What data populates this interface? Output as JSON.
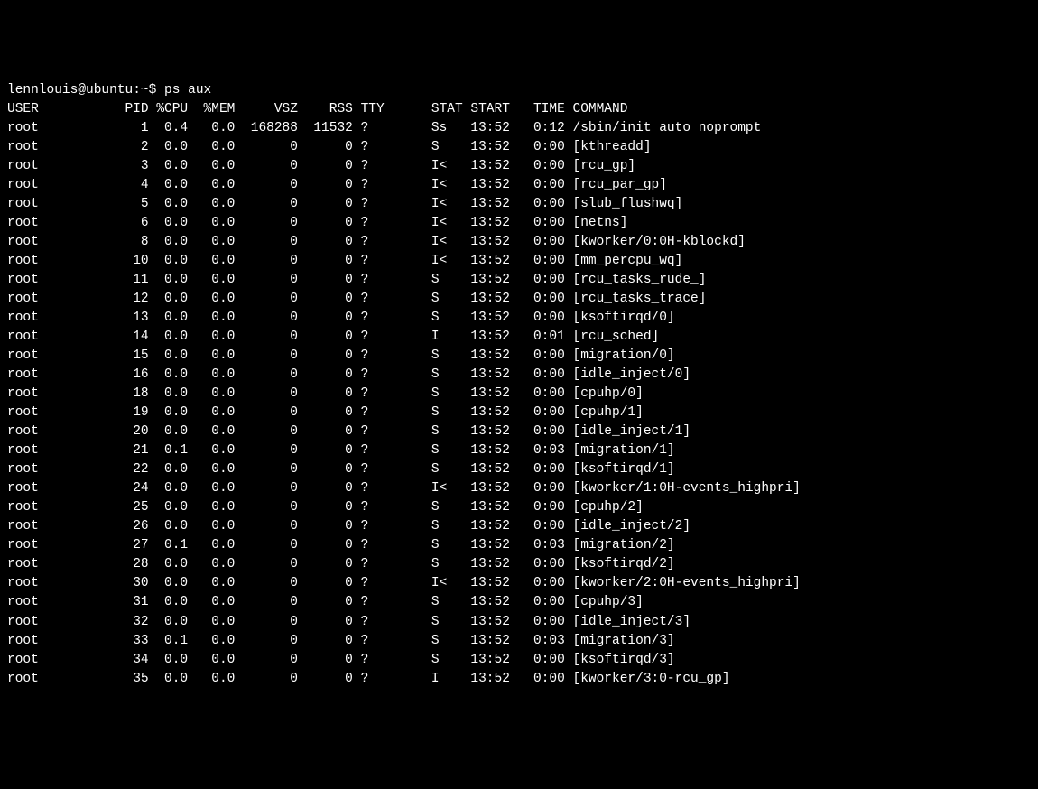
{
  "prompt": "lennlouis@ubuntu:~$ ",
  "command": "ps aux",
  "header": {
    "user": "USER",
    "pid": "PID",
    "cpu": "%CPU",
    "mem": "%MEM",
    "vsz": "VSZ",
    "rss": "RSS",
    "tty": "TTY",
    "stat": "STAT",
    "start": "START",
    "time": "TIME",
    "command": "COMMAND"
  },
  "rows": [
    {
      "user": "root",
      "pid": "1",
      "cpu": "0.4",
      "mem": "0.0",
      "vsz": "168288",
      "rss": "11532",
      "tty": "?",
      "stat": "Ss",
      "start": "13:52",
      "time": "0:12",
      "command": "/sbin/init auto noprompt"
    },
    {
      "user": "root",
      "pid": "2",
      "cpu": "0.0",
      "mem": "0.0",
      "vsz": "0",
      "rss": "0",
      "tty": "?",
      "stat": "S",
      "start": "13:52",
      "time": "0:00",
      "command": "[kthreadd]"
    },
    {
      "user": "root",
      "pid": "3",
      "cpu": "0.0",
      "mem": "0.0",
      "vsz": "0",
      "rss": "0",
      "tty": "?",
      "stat": "I<",
      "start": "13:52",
      "time": "0:00",
      "command": "[rcu_gp]"
    },
    {
      "user": "root",
      "pid": "4",
      "cpu": "0.0",
      "mem": "0.0",
      "vsz": "0",
      "rss": "0",
      "tty": "?",
      "stat": "I<",
      "start": "13:52",
      "time": "0:00",
      "command": "[rcu_par_gp]"
    },
    {
      "user": "root",
      "pid": "5",
      "cpu": "0.0",
      "mem": "0.0",
      "vsz": "0",
      "rss": "0",
      "tty": "?",
      "stat": "I<",
      "start": "13:52",
      "time": "0:00",
      "command": "[slub_flushwq]"
    },
    {
      "user": "root",
      "pid": "6",
      "cpu": "0.0",
      "mem": "0.0",
      "vsz": "0",
      "rss": "0",
      "tty": "?",
      "stat": "I<",
      "start": "13:52",
      "time": "0:00",
      "command": "[netns]"
    },
    {
      "user": "root",
      "pid": "8",
      "cpu": "0.0",
      "mem": "0.0",
      "vsz": "0",
      "rss": "0",
      "tty": "?",
      "stat": "I<",
      "start": "13:52",
      "time": "0:00",
      "command": "[kworker/0:0H-kblockd]"
    },
    {
      "user": "root",
      "pid": "10",
      "cpu": "0.0",
      "mem": "0.0",
      "vsz": "0",
      "rss": "0",
      "tty": "?",
      "stat": "I<",
      "start": "13:52",
      "time": "0:00",
      "command": "[mm_percpu_wq]"
    },
    {
      "user": "root",
      "pid": "11",
      "cpu": "0.0",
      "mem": "0.0",
      "vsz": "0",
      "rss": "0",
      "tty": "?",
      "stat": "S",
      "start": "13:52",
      "time": "0:00",
      "command": "[rcu_tasks_rude_]"
    },
    {
      "user": "root",
      "pid": "12",
      "cpu": "0.0",
      "mem": "0.0",
      "vsz": "0",
      "rss": "0",
      "tty": "?",
      "stat": "S",
      "start": "13:52",
      "time": "0:00",
      "command": "[rcu_tasks_trace]"
    },
    {
      "user": "root",
      "pid": "13",
      "cpu": "0.0",
      "mem": "0.0",
      "vsz": "0",
      "rss": "0",
      "tty": "?",
      "stat": "S",
      "start": "13:52",
      "time": "0:00",
      "command": "[ksoftirqd/0]"
    },
    {
      "user": "root",
      "pid": "14",
      "cpu": "0.0",
      "mem": "0.0",
      "vsz": "0",
      "rss": "0",
      "tty": "?",
      "stat": "I",
      "start": "13:52",
      "time": "0:01",
      "command": "[rcu_sched]"
    },
    {
      "user": "root",
      "pid": "15",
      "cpu": "0.0",
      "mem": "0.0",
      "vsz": "0",
      "rss": "0",
      "tty": "?",
      "stat": "S",
      "start": "13:52",
      "time": "0:00",
      "command": "[migration/0]"
    },
    {
      "user": "root",
      "pid": "16",
      "cpu": "0.0",
      "mem": "0.0",
      "vsz": "0",
      "rss": "0",
      "tty": "?",
      "stat": "S",
      "start": "13:52",
      "time": "0:00",
      "command": "[idle_inject/0]"
    },
    {
      "user": "root",
      "pid": "18",
      "cpu": "0.0",
      "mem": "0.0",
      "vsz": "0",
      "rss": "0",
      "tty": "?",
      "stat": "S",
      "start": "13:52",
      "time": "0:00",
      "command": "[cpuhp/0]"
    },
    {
      "user": "root",
      "pid": "19",
      "cpu": "0.0",
      "mem": "0.0",
      "vsz": "0",
      "rss": "0",
      "tty": "?",
      "stat": "S",
      "start": "13:52",
      "time": "0:00",
      "command": "[cpuhp/1]"
    },
    {
      "user": "root",
      "pid": "20",
      "cpu": "0.0",
      "mem": "0.0",
      "vsz": "0",
      "rss": "0",
      "tty": "?",
      "stat": "S",
      "start": "13:52",
      "time": "0:00",
      "command": "[idle_inject/1]"
    },
    {
      "user": "root",
      "pid": "21",
      "cpu": "0.1",
      "mem": "0.0",
      "vsz": "0",
      "rss": "0",
      "tty": "?",
      "stat": "S",
      "start": "13:52",
      "time": "0:03",
      "command": "[migration/1]"
    },
    {
      "user": "root",
      "pid": "22",
      "cpu": "0.0",
      "mem": "0.0",
      "vsz": "0",
      "rss": "0",
      "tty": "?",
      "stat": "S",
      "start": "13:52",
      "time": "0:00",
      "command": "[ksoftirqd/1]"
    },
    {
      "user": "root",
      "pid": "24",
      "cpu": "0.0",
      "mem": "0.0",
      "vsz": "0",
      "rss": "0",
      "tty": "?",
      "stat": "I<",
      "start": "13:52",
      "time": "0:00",
      "command": "[kworker/1:0H-events_highpri]"
    },
    {
      "user": "root",
      "pid": "25",
      "cpu": "0.0",
      "mem": "0.0",
      "vsz": "0",
      "rss": "0",
      "tty": "?",
      "stat": "S",
      "start": "13:52",
      "time": "0:00",
      "command": "[cpuhp/2]"
    },
    {
      "user": "root",
      "pid": "26",
      "cpu": "0.0",
      "mem": "0.0",
      "vsz": "0",
      "rss": "0",
      "tty": "?",
      "stat": "S",
      "start": "13:52",
      "time": "0:00",
      "command": "[idle_inject/2]"
    },
    {
      "user": "root",
      "pid": "27",
      "cpu": "0.1",
      "mem": "0.0",
      "vsz": "0",
      "rss": "0",
      "tty": "?",
      "stat": "S",
      "start": "13:52",
      "time": "0:03",
      "command": "[migration/2]"
    },
    {
      "user": "root",
      "pid": "28",
      "cpu": "0.0",
      "mem": "0.0",
      "vsz": "0",
      "rss": "0",
      "tty": "?",
      "stat": "S",
      "start": "13:52",
      "time": "0:00",
      "command": "[ksoftirqd/2]"
    },
    {
      "user": "root",
      "pid": "30",
      "cpu": "0.0",
      "mem": "0.0",
      "vsz": "0",
      "rss": "0",
      "tty": "?",
      "stat": "I<",
      "start": "13:52",
      "time": "0:00",
      "command": "[kworker/2:0H-events_highpri]"
    },
    {
      "user": "root",
      "pid": "31",
      "cpu": "0.0",
      "mem": "0.0",
      "vsz": "0",
      "rss": "0",
      "tty": "?",
      "stat": "S",
      "start": "13:52",
      "time": "0:00",
      "command": "[cpuhp/3]"
    },
    {
      "user": "root",
      "pid": "32",
      "cpu": "0.0",
      "mem": "0.0",
      "vsz": "0",
      "rss": "0",
      "tty": "?",
      "stat": "S",
      "start": "13:52",
      "time": "0:00",
      "command": "[idle_inject/3]"
    },
    {
      "user": "root",
      "pid": "33",
      "cpu": "0.1",
      "mem": "0.0",
      "vsz": "0",
      "rss": "0",
      "tty": "?",
      "stat": "S",
      "start": "13:52",
      "time": "0:03",
      "command": "[migration/3]"
    },
    {
      "user": "root",
      "pid": "34",
      "cpu": "0.0",
      "mem": "0.0",
      "vsz": "0",
      "rss": "0",
      "tty": "?",
      "stat": "S",
      "start": "13:52",
      "time": "0:00",
      "command": "[ksoftirqd/3]"
    },
    {
      "user": "root",
      "pid": "35",
      "cpu": "0.0",
      "mem": "0.0",
      "vsz": "0",
      "rss": "0",
      "tty": "?",
      "stat": "I",
      "start": "13:52",
      "time": "0:00",
      "command": "[kworker/3:0-rcu_gp]"
    }
  ]
}
